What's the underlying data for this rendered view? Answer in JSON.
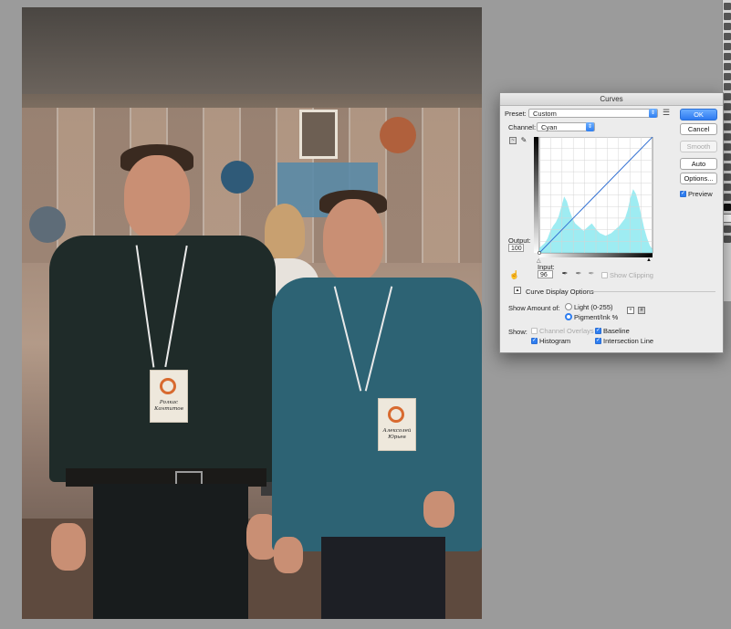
{
  "dialog": {
    "title": "Curves",
    "preset_label": "Preset:",
    "preset_value": "Custom",
    "channel_label": "Channel:",
    "channel_value": "Cyan",
    "output_label": "Output:",
    "output_value": "100",
    "input_label": "Input:",
    "input_value": "96",
    "show_clipping_label": "Show Clipping",
    "curve_display_options_label": "Curve Display Options",
    "show_amount_label": "Show Amount of:",
    "amount_options": [
      "Light  (0-255)",
      "Pigment/Ink %"
    ],
    "amount_selected": "Pigment/Ink %",
    "show_label": "Show:",
    "show_options": {
      "channel_overlays": "Channel Overlays",
      "baseline": "Baseline",
      "histogram": "Histogram",
      "intersection_line": "Intersection Line"
    },
    "buttons": {
      "ok": "OK",
      "cancel": "Cancel",
      "smooth": "Smooth",
      "auto": "Auto",
      "options": "Options..."
    },
    "preview_label": "Preview",
    "curve": {
      "points": [
        [
          0,
          0
        ],
        [
          100,
          100
        ]
      ],
      "histogram": [
        4,
        6,
        8,
        12,
        18,
        22,
        25,
        30,
        38,
        46,
        42,
        34,
        28,
        24,
        22,
        20,
        18,
        20,
        22,
        24,
        21,
        18,
        16,
        15,
        14,
        15,
        16,
        18,
        20,
        22,
        25,
        28,
        35,
        45,
        52,
        48,
        40,
        30,
        20,
        12,
        6,
        3
      ],
      "accent_color": "#7ee6ee"
    }
  },
  "badges": {
    "left": "Ролкас Кантитов",
    "right": "Алексолей Юрьев"
  },
  "colors": {
    "canvas_bg": "#9b9b9b",
    "dialog_bg": "#ececec",
    "primary_button": "#2e7af0"
  }
}
